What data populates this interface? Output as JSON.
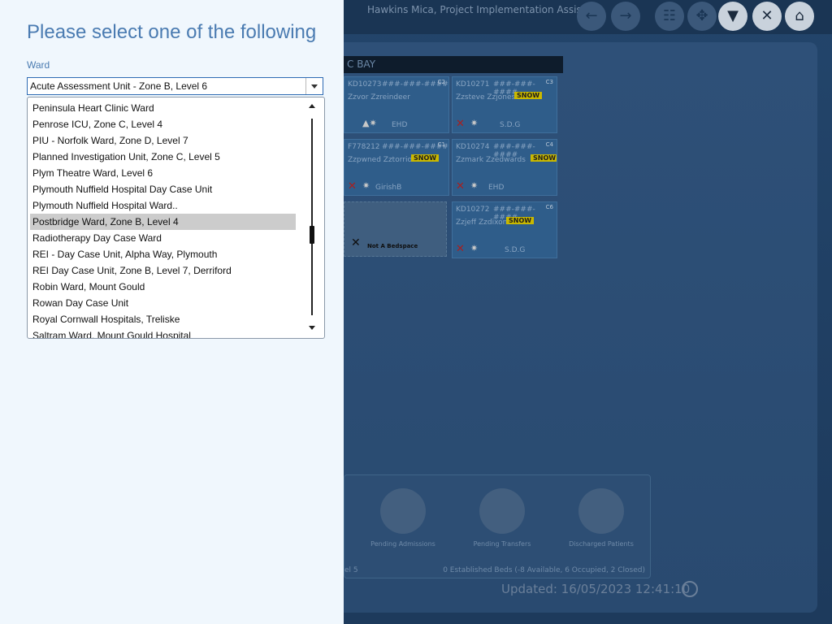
{
  "background": {
    "user": "Hawkins Mica, Project Implementation Assistant",
    "bay": "C BAY",
    "beds": [
      {
        "id": "KD10273",
        "mask": "###-###-####",
        "name": "Zzvor Zzreindeer",
        "slot": "C2",
        "who": "EHD",
        "snow": ""
      },
      {
        "id": "KD10271",
        "mask": "###-###-####",
        "name": "Zzsteve Zzjones",
        "slot": "C3",
        "who": "S.D.G",
        "snow": "SNOW"
      },
      {
        "id": "F778212",
        "mask": "###-###-####",
        "name": "Zzpwned Zztorrio",
        "slot": "C1",
        "who": "GirishB",
        "snow": "SNOW"
      },
      {
        "id": "KD10274",
        "mask": "###-###-####",
        "name": "Zzmark Zzedwards",
        "slot": "C4",
        "who": "EHD",
        "snow": "SNOW"
      },
      {
        "id": "KD10272",
        "mask": "###-###-####",
        "name": "Zzjeff Zzdixon",
        "slot": "C6",
        "who": "S.D.G",
        "snow": "SNOW"
      }
    ],
    "not_bedspace": "Not A Bedspace",
    "summary": {
      "pending_admissions": "Pending Admissions",
      "pending_transfers": "Pending Transfers",
      "discharged_patients": "Discharged Patients",
      "level": "el 5",
      "beds": "0 Established Beds (-8 Available, 6 Occupied, 2 Closed)"
    },
    "updated": "Updated: 16/05/2023 12:41:10"
  },
  "panel": {
    "title": "Please select one of the following",
    "field_label": "Ward",
    "selected_value": "Acute Assessment Unit - Zone B, Level 6",
    "highlighted": "Postbridge Ward, Zone B, Level 4",
    "items": [
      "Peninsula Heart Clinic Ward",
      "Penrose ICU, Zone C, Level 4",
      "PIU - Norfolk Ward, Zone D, Level 7",
      "Planned Investigation Unit, Zone C, Level 5",
      "Plym Theatre Ward, Level 6",
      "Plymouth Nuffield Hospital Day Case Unit",
      "Plymouth Nuffield Hospital Ward..",
      "Postbridge Ward, Zone B, Level 4",
      "Radiotherapy Day Case Ward",
      "REI - Day Case Unit, Alpha Way, Plymouth",
      "REI Day Case Unit, Zone B, Level 7, Derriford",
      "Robin Ward, Mount Gould",
      "Rowan Day Case Unit",
      "Royal Cornwall Hospitals, Treliske",
      "Saltram Ward, Mount Gould Hospital"
    ]
  },
  "colors": {
    "panel_bg": "#f0f7fd",
    "accent": "#4a7bb1",
    "selected_item": "#cccccc"
  }
}
